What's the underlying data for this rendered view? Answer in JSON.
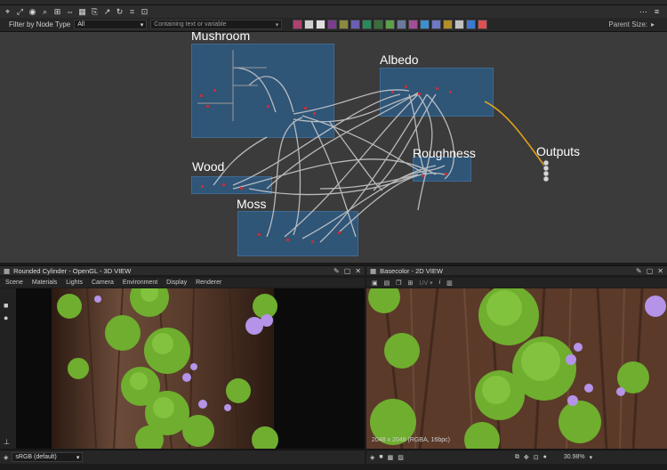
{
  "toolbar": {
    "icons": [
      "select-icon",
      "fit-icon",
      "camera-icon",
      "search-icon",
      "layout-icon",
      "align-icon",
      "grid-icon",
      "link-icon",
      "reroute-icon",
      "refresh-icon",
      "frame-icon",
      "screenshot-icon"
    ],
    "right_icons": [
      "more-icon",
      "menu-icon"
    ]
  },
  "filter": {
    "label": "Filter by Node Type",
    "type_value": "All",
    "search_placeholder": "Containing text or variable",
    "parent_size_label": "Parent Size:",
    "node_icons": [
      "#b04070",
      "#d0d0d0",
      "#e0e0e0",
      "#7a3d8f",
      "#8a8a40",
      "#6b5fb0",
      "#2a8a5a",
      "#3a6f3a",
      "#5ea04a",
      "#6a7a9a",
      "#a24f98",
      "#3b8fd0",
      "#6f77c7",
      "#b38f2a",
      "#c0c0c0",
      "#3b7ad0",
      "#e05050"
    ]
  },
  "graph": {
    "frames": [
      {
        "title": "Mushroom"
      },
      {
        "title": "Albedo"
      },
      {
        "title": "Roughness"
      },
      {
        "title": "Wood"
      },
      {
        "title": "Moss"
      },
      {
        "title": "Outputs"
      }
    ]
  },
  "view3d": {
    "title": "Rounded Cylinder - OpenGL - 3D VIEW",
    "menu": [
      "Scene",
      "Materials",
      "Lights",
      "Camera",
      "Environment",
      "Display",
      "Renderer"
    ],
    "colorspace": "sRGB (default)"
  },
  "view2d": {
    "title": "Basecolor - 2D VIEW",
    "uv_label": "UV",
    "info": "2048 x 2048 (RGBA, 16bpc)",
    "zoom": "30.98%"
  },
  "colors": {
    "accent": "#e3a21a",
    "frame": "#2f5577",
    "wire": "#c9c9c9",
    "bark": "#5a3a2a",
    "moss": "#6fae2e"
  }
}
